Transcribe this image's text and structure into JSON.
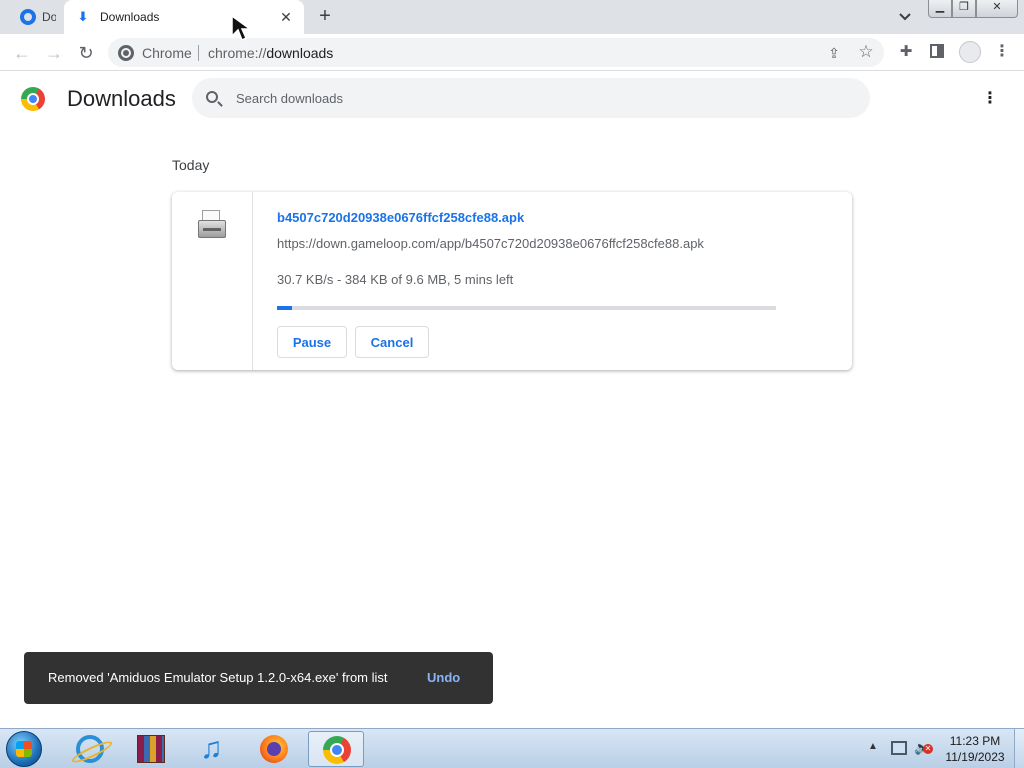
{
  "browser": {
    "tabs": [
      {
        "label": "Do",
        "icon": "chrome-page-icon",
        "active": false
      },
      {
        "label": "Downloads",
        "icon": "download-icon",
        "active": true
      }
    ],
    "new_tab_symbol": "+",
    "tab_close_symbol": "✕",
    "window_controls": {
      "minimize": "▁",
      "maximize": "❐",
      "close": "✕"
    }
  },
  "toolbar": {
    "omnibox_label": "Chrome",
    "url_scheme": "chrome://",
    "url_host": "downloads"
  },
  "page": {
    "title": "Downloads",
    "search_placeholder": "Search downloads",
    "section_date": "Today"
  },
  "downloads": [
    {
      "file_name": "b4507c720d20938e0676ffcf258cfe88.apk",
      "url": "https://down.gameloop.com/app/b4507c720d20938e0676ffcf258cfe88.apk",
      "status": "30.7 KB/s - 384 KB of 9.6 MB, 5 mins left",
      "progress_percent": 3,
      "pause_label": "Pause",
      "cancel_label": "Cancel"
    }
  ],
  "toast": {
    "message": "Removed 'Amiduos Emulator Setup 1.2.0-x64.exe' from list",
    "undo_label": "Undo"
  },
  "taskbar": {
    "apps": [
      "internet-explorer",
      "winrar",
      "itunes",
      "firefox",
      "chrome"
    ],
    "clock_time": "11:23 PM",
    "clock_date": "11/19/2023"
  },
  "colors": {
    "accent": "#1a73e8",
    "toast_bg": "#323232",
    "toast_action": "#8ab4f8"
  }
}
